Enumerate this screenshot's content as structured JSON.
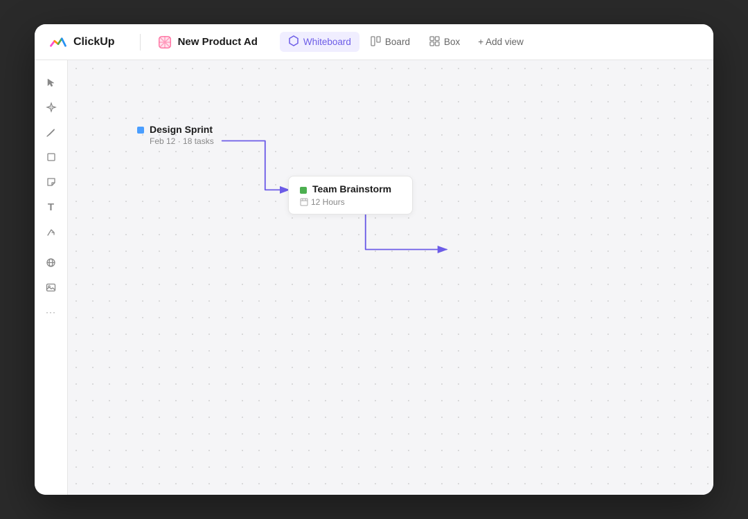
{
  "app": {
    "name": "ClickUp"
  },
  "header": {
    "project_icon_alt": "pink-box-icon",
    "project_title": "New Product Ad",
    "nav_items": [
      {
        "id": "whiteboard",
        "label": "Whiteboard",
        "active": true,
        "icon": "⬡"
      },
      {
        "id": "board",
        "label": "Board",
        "active": false,
        "icon": "▦"
      },
      {
        "id": "box",
        "label": "Box",
        "active": false,
        "icon": "⊞"
      }
    ],
    "add_view_label": "+ Add view"
  },
  "toolbar": {
    "tools": [
      {
        "id": "cursor",
        "icon": "⬆",
        "label": "cursor-tool"
      },
      {
        "id": "add",
        "icon": "✦",
        "label": "add-tool"
      },
      {
        "id": "pen",
        "icon": "✏",
        "label": "pen-tool"
      },
      {
        "id": "rectangle",
        "icon": "□",
        "label": "rectangle-tool"
      },
      {
        "id": "sticky",
        "icon": "◱",
        "label": "sticky-tool"
      },
      {
        "id": "text",
        "icon": "T",
        "label": "text-tool"
      },
      {
        "id": "connect",
        "icon": "↗",
        "label": "connect-tool"
      },
      {
        "id": "globe",
        "icon": "⊕",
        "label": "embed-tool"
      },
      {
        "id": "image",
        "icon": "⬚",
        "label": "image-tool"
      },
      {
        "id": "more",
        "icon": "•••",
        "label": "more-tools"
      }
    ]
  },
  "canvas": {
    "cards": [
      {
        "id": "design-sprint",
        "title": "Design Sprint",
        "meta": "Feb 12  ·  18 tasks",
        "color": "#4a9eff",
        "type": "plain"
      },
      {
        "id": "team-brainstorm",
        "title": "Team Brainstorm",
        "meta_icon": "⊞",
        "meta": "12 Hours",
        "color": "#4caf50",
        "type": "card"
      }
    ]
  }
}
